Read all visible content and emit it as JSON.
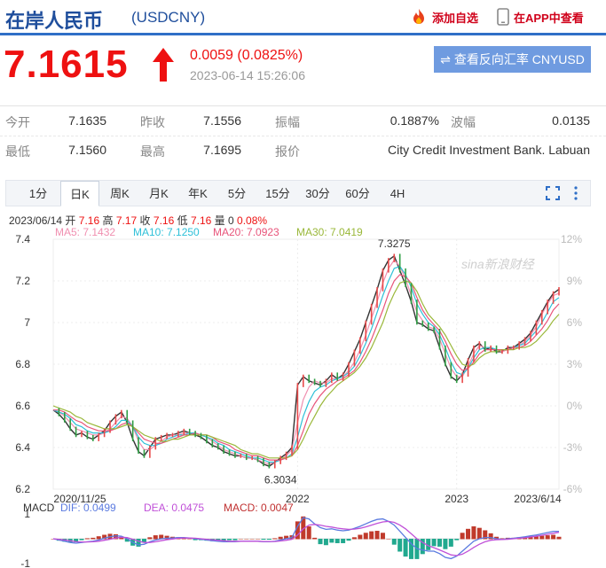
{
  "header": {
    "title": "在岸人民币",
    "code": "(USDCNY)",
    "add_watchlist": "添加自选",
    "app_view": "在APP中查看"
  },
  "quote": {
    "price": "7.1615",
    "change": "0.0059 (0.0825%)",
    "timestamp": "2023-06-14 15:26:06",
    "reverse_button": "查看反向汇率 CNYUSD"
  },
  "info": [
    {
      "label": "今开",
      "value": "7.1635"
    },
    {
      "label": "昨收",
      "value": "7.1556"
    },
    {
      "label": "振幅",
      "value": "0.1887%"
    },
    {
      "label": "波幅",
      "value": "0.0135"
    },
    {
      "label": "最低",
      "value": "7.1560"
    },
    {
      "label": "最高",
      "value": "7.1695"
    },
    {
      "label": "报价",
      "value": "City Credit Investment Bank. Labuan"
    }
  ],
  "tabs": [
    "1分",
    "日K",
    "周K",
    "月K",
    "年K",
    "5分",
    "15分",
    "30分",
    "60分",
    "4H"
  ],
  "active_tab": "日K",
  "ohlc": {
    "date": "2023/06/14",
    "open_label": "开",
    "open": "7.16",
    "high_label": "高",
    "high": "7.17",
    "close_label": "收",
    "close": "7.16",
    "low_label": "低",
    "low": "7.16",
    "volume_label": "量",
    "volume": "0",
    "pct": "0.08%"
  },
  "ma_legend": [
    {
      "text": "MA5: 7.1432",
      "color": "#f08fb0"
    },
    {
      "text": "MA10: 7.1250",
      "color": "#2ec0d8"
    },
    {
      "text": "MA20: 7.0923",
      "color": "#e8547a"
    },
    {
      "text": "MA30: 7.0419",
      "color": "#9ab83a"
    }
  ],
  "watermark": "sina新浪财经",
  "chart_data": {
    "type": "line",
    "title": "",
    "ylim": [
      6.2,
      7.4
    ],
    "y_ticks": [
      "7.4",
      "7.2",
      "7",
      "6.8",
      "6.6",
      "6.4",
      "6.2"
    ],
    "pct_ticks": [
      "12%",
      "9%",
      "6%",
      "3%",
      "0%",
      "-3%",
      "-6%"
    ],
    "x_ticks": [
      "2020/11/25",
      "2022",
      "2023",
      "2023/6/14"
    ],
    "annotations": [
      {
        "text": "7.3275",
        "value": 7.3275
      },
      {
        "text": "6.3034",
        "value": 6.3034
      }
    ],
    "series": [
      {
        "name": "",
        "color": "#333",
        "values": [
          6.58,
          6.56,
          6.53,
          6.49,
          6.46,
          6.47,
          6.45,
          6.44,
          6.46,
          6.48,
          6.52,
          6.55,
          6.57,
          6.52,
          6.44,
          6.38,
          6.36,
          6.4,
          6.44,
          6.45,
          6.46,
          6.46,
          6.47,
          6.48,
          6.47,
          6.46,
          6.45,
          6.43,
          6.41,
          6.4,
          6.38,
          6.37,
          6.36,
          6.36,
          6.35,
          6.35,
          6.34,
          6.32,
          6.31,
          6.33,
          6.35,
          6.37,
          6.4,
          6.7,
          6.74,
          6.72,
          6.71,
          6.7,
          6.72,
          6.75,
          6.73,
          6.75,
          6.8,
          6.86,
          6.92,
          7.0,
          7.08,
          7.16,
          7.25,
          7.3,
          7.32,
          7.25,
          7.18,
          7.1,
          7.0,
          6.99,
          6.97,
          6.96,
          6.88,
          6.8,
          6.74,
          6.72,
          6.75,
          6.82,
          6.88,
          6.9,
          6.87,
          6.88,
          6.86,
          6.86,
          6.88,
          6.88,
          6.9,
          6.92,
          6.95,
          7.0,
          7.05,
          7.1,
          7.14,
          7.16
        ]
      },
      {
        "name": "",
        "color": "#f08fb0",
        "values": [
          6.58,
          6.57,
          6.55,
          6.52,
          6.49,
          6.48,
          6.47,
          6.46,
          6.46,
          6.47,
          6.49,
          6.52,
          6.55,
          6.54,
          6.5,
          6.43,
          6.39,
          6.39,
          6.41,
          6.43,
          6.45,
          6.46,
          6.46,
          6.47,
          6.47,
          6.47,
          6.46,
          6.45,
          6.43,
          6.41,
          6.39,
          6.38,
          6.37,
          6.36,
          6.35,
          6.35,
          6.34,
          6.33,
          6.32,
          6.33,
          6.34,
          6.36,
          6.39,
          6.52,
          6.63,
          6.69,
          6.72,
          6.71,
          6.71,
          6.73,
          6.73,
          6.74,
          6.77,
          6.81,
          6.87,
          6.94,
          7.02,
          7.1,
          7.19,
          7.26,
          7.3,
          7.27,
          7.21,
          7.13,
          7.05,
          7.01,
          6.98,
          6.97,
          6.92,
          6.85,
          6.78,
          6.74,
          6.74,
          6.79,
          6.85,
          6.89,
          6.88,
          6.88,
          6.87,
          6.86,
          6.87,
          6.88,
          6.89,
          6.91,
          6.94,
          6.98,
          7.04,
          7.09,
          7.13,
          7.14
        ]
      },
      {
        "name": "",
        "color": "#2ec0d8",
        "values": [
          6.58,
          6.57,
          6.56,
          6.54,
          6.51,
          6.5,
          6.48,
          6.47,
          6.47,
          6.47,
          6.48,
          6.5,
          6.53,
          6.53,
          6.5,
          6.45,
          6.42,
          6.41,
          6.41,
          6.42,
          6.44,
          6.45,
          6.46,
          6.46,
          6.47,
          6.47,
          6.46,
          6.45,
          6.44,
          6.42,
          6.41,
          6.39,
          6.38,
          6.37,
          6.36,
          6.35,
          6.35,
          6.34,
          6.33,
          6.33,
          6.34,
          6.35,
          6.37,
          6.45,
          6.55,
          6.62,
          6.67,
          6.69,
          6.7,
          6.72,
          6.73,
          6.74,
          6.76,
          6.79,
          6.84,
          6.9,
          6.97,
          7.05,
          7.13,
          7.2,
          7.26,
          7.27,
          7.23,
          7.17,
          7.09,
          7.04,
          7.0,
          6.98,
          6.94,
          6.88,
          6.81,
          6.76,
          6.75,
          6.78,
          6.83,
          6.87,
          6.88,
          6.88,
          6.87,
          6.87,
          6.87,
          6.88,
          6.89,
          6.9,
          6.93,
          6.96,
          7.0,
          7.05,
          7.1,
          7.12
        ]
      },
      {
        "name": "",
        "color": "#e8547a",
        "values": [
          6.58,
          6.58,
          6.57,
          6.55,
          6.53,
          6.52,
          6.5,
          6.49,
          6.48,
          6.48,
          6.48,
          6.49,
          6.51,
          6.52,
          6.5,
          6.47,
          6.44,
          6.43,
          6.42,
          6.42,
          6.43,
          6.44,
          6.45,
          6.46,
          6.46,
          6.47,
          6.46,
          6.46,
          6.45,
          6.43,
          6.42,
          6.41,
          6.39,
          6.38,
          6.37,
          6.36,
          6.36,
          6.35,
          6.34,
          6.34,
          6.34,
          6.35,
          6.36,
          6.41,
          6.48,
          6.56,
          6.61,
          6.65,
          6.68,
          6.7,
          6.72,
          6.73,
          6.75,
          6.77,
          6.81,
          6.86,
          6.92,
          6.99,
          7.06,
          7.14,
          7.2,
          7.23,
          7.22,
          7.19,
          7.12,
          7.06,
          7.02,
          6.99,
          6.96,
          6.91,
          6.85,
          6.8,
          6.77,
          6.78,
          6.81,
          6.85,
          6.87,
          6.87,
          6.87,
          6.87,
          6.87,
          6.88,
          6.88,
          6.89,
          6.91,
          6.94,
          6.97,
          7.01,
          7.06,
          7.09
        ]
      },
      {
        "name": "",
        "color": "#9ab83a",
        "values": [
          6.6,
          6.59,
          6.58,
          6.57,
          6.55,
          6.54,
          6.52,
          6.51,
          6.5,
          6.49,
          6.49,
          6.49,
          6.5,
          6.51,
          6.5,
          6.48,
          6.46,
          6.45,
          6.44,
          6.43,
          6.43,
          6.44,
          6.44,
          6.45,
          6.46,
          6.46,
          6.46,
          6.46,
          6.45,
          6.44,
          6.43,
          6.42,
          6.41,
          6.39,
          6.38,
          6.37,
          6.37,
          6.36,
          6.35,
          6.35,
          6.35,
          6.35,
          6.36,
          6.39,
          6.44,
          6.5,
          6.55,
          6.6,
          6.64,
          6.67,
          6.7,
          6.72,
          6.74,
          6.76,
          6.79,
          6.83,
          6.88,
          6.94,
          7.0,
          7.08,
          7.14,
          7.19,
          7.2,
          7.19,
          7.15,
          7.09,
          7.04,
          7.01,
          6.98,
          6.94,
          6.89,
          6.84,
          6.8,
          6.79,
          6.8,
          6.83,
          6.85,
          6.86,
          6.86,
          6.87,
          6.87,
          6.87,
          6.88,
          6.88,
          6.89,
          6.91,
          6.94,
          6.97,
          7.01,
          7.04
        ]
      }
    ],
    "macd": {
      "ylim": [
        -1,
        1
      ],
      "y_ticks": [
        "1",
        "-1"
      ],
      "label": "MACD",
      "dif": "DIF: 0.0499",
      "dif_color": "#5b7be0",
      "dea": "DEA: 0.0475",
      "dea_color": "#c050d8",
      "macd": "MACD: 0.0047",
      "macd_color": "#c03030",
      "dif_values": [
        0.0,
        -0.05,
        -0.1,
        -0.15,
        -0.18,
        -0.15,
        -0.12,
        -0.1,
        -0.05,
        0.02,
        0.08,
        0.12,
        0.1,
        0.0,
        -0.15,
        -0.25,
        -0.22,
        -0.12,
        -0.05,
        0.0,
        0.02,
        0.03,
        0.05,
        0.05,
        0.03,
        0.0,
        -0.02,
        -0.05,
        -0.08,
        -0.1,
        -0.12,
        -0.12,
        -0.12,
        -0.1,
        -0.1,
        -0.1,
        -0.1,
        -0.12,
        -0.12,
        -0.1,
        -0.05,
        0.0,
        0.05,
        0.5,
        0.85,
        0.8,
        0.6,
        0.45,
        0.38,
        0.4,
        0.35,
        0.32,
        0.35,
        0.42,
        0.5,
        0.6,
        0.7,
        0.78,
        0.8,
        0.7,
        0.55,
        0.3,
        0.05,
        -0.2,
        -0.4,
        -0.45,
        -0.5,
        -0.5,
        -0.6,
        -0.75,
        -0.8,
        -0.7,
        -0.5,
        -0.3,
        -0.1,
        0.0,
        0.05,
        0.05,
        0.0,
        -0.02,
        0.0,
        0.02,
        0.05,
        0.08,
        0.12,
        0.15,
        0.2,
        0.25,
        0.3,
        0.3
      ],
      "dea_values": [
        0.0,
        -0.02,
        -0.05,
        -0.08,
        -0.12,
        -0.13,
        -0.13,
        -0.12,
        -0.1,
        -0.06,
        -0.02,
        0.03,
        0.06,
        0.05,
        -0.02,
        -0.1,
        -0.15,
        -0.15,
        -0.12,
        -0.08,
        -0.04,
        -0.01,
        0.02,
        0.03,
        0.03,
        0.02,
        0.0,
        -0.02,
        -0.04,
        -0.06,
        -0.08,
        -0.1,
        -0.1,
        -0.1,
        -0.1,
        -0.1,
        -0.1,
        -0.11,
        -0.11,
        -0.11,
        -0.09,
        -0.06,
        -0.02,
        0.15,
        0.4,
        0.55,
        0.58,
        0.55,
        0.5,
        0.47,
        0.43,
        0.4,
        0.38,
        0.39,
        0.42,
        0.48,
        0.55,
        0.62,
        0.68,
        0.7,
        0.66,
        0.55,
        0.4,
        0.2,
        0.0,
        -0.15,
        -0.28,
        -0.36,
        -0.45,
        -0.55,
        -0.65,
        -0.68,
        -0.62,
        -0.5,
        -0.35,
        -0.22,
        -0.12,
        -0.06,
        -0.04,
        -0.03,
        -0.02,
        0.0,
        0.02,
        0.04,
        0.07,
        0.1,
        0.14,
        0.18,
        0.22,
        0.26
      ]
    }
  }
}
